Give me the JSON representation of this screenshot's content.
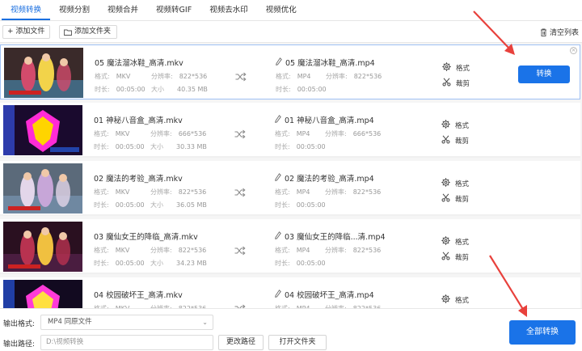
{
  "tabs": [
    {
      "label": "视频转换",
      "active": true
    },
    {
      "label": "视频分割",
      "active": false
    },
    {
      "label": "视频合并",
      "active": false
    },
    {
      "label": "视频转GIF",
      "active": false
    },
    {
      "label": "视频去水印",
      "active": false
    },
    {
      "label": "视频优化",
      "active": false
    }
  ],
  "toolbar": {
    "add_file": "+ 添加文件",
    "add_folder": "添加文件夹",
    "clear_list": "清空列表"
  },
  "labels": {
    "format": "格式:",
    "resolution": "分辨率:",
    "duration": "时长:",
    "size": "大小",
    "fmt_action": "格式",
    "cut_action": "裁剪",
    "convert": "转换"
  },
  "items": [
    {
      "src_name": "05 魔法溜冰鞋_高清.mkv",
      "src_format": "MKV",
      "src_res": "822*536",
      "src_dur": "00:05:00",
      "src_size": "40.35 MB",
      "dst_name": "05 魔法溜冰鞋_高清.mp4",
      "dst_format": "MP4",
      "dst_res": "822*536",
      "dst_dur": "00:05:00"
    },
    {
      "src_name": "01 神秘八音盒_高清.mkv",
      "src_format": "MKV",
      "src_res": "666*536",
      "src_dur": "00:05:00",
      "src_size": "30.33 MB",
      "dst_name": "01 神秘八音盒_高清.mp4",
      "dst_format": "MP4",
      "dst_res": "666*536",
      "dst_dur": "00:05:00"
    },
    {
      "src_name": "02 魔法的考验_高清.mkv",
      "src_format": "MKV",
      "src_res": "822*536",
      "src_dur": "00:05:00",
      "src_size": "36.05 MB",
      "dst_name": "02 魔法的考验_高清.mp4",
      "dst_format": "MP4",
      "dst_res": "822*536",
      "dst_dur": "00:05:00"
    },
    {
      "src_name": "03 魔仙女王的降临_高清.mkv",
      "src_format": "MKV",
      "src_res": "822*536",
      "src_dur": "00:05:00",
      "src_size": "34.23 MB",
      "dst_name": "03 魔仙女王的降临...清.mp4",
      "dst_format": "MP4",
      "dst_res": "822*536",
      "dst_dur": "00:05:00"
    },
    {
      "src_name": "04 校园破坏王_高清.mkv",
      "src_format": "MKV",
      "src_res": "822*536",
      "src_dur": "00:05:00",
      "src_size": "",
      "dst_name": "04 校园破坏王_高清.mp4",
      "dst_format": "MP4",
      "dst_res": "822*536",
      "dst_dur": "00:05:00"
    }
  ],
  "bottom": {
    "output_format_label": "输出格式:",
    "output_format_value": "MP4  同原文件",
    "output_path_label": "输出路径:",
    "output_path_value": "D:\\视频转换",
    "change_path": "更改路径",
    "open_folder": "打开文件夹",
    "convert_all": "全部转换"
  },
  "colors": {
    "accent": "#1a73e8",
    "annotation": "#e8413c"
  }
}
